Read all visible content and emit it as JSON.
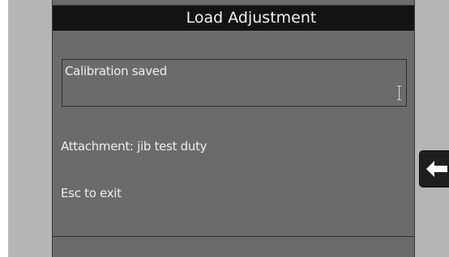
{
  "header": {
    "title": "Load Adjustment"
  },
  "message_box": {
    "text": "Calibration saved"
  },
  "info": {
    "attachment": "Attachment: jib test duty",
    "exit_hint": "Esc to exit"
  },
  "controls": {
    "back_icon": "arrow-left-icon"
  },
  "colors": {
    "screen_background": "#6d6a6b",
    "title_bar": "#141212",
    "bezel": "#b5b5b5",
    "text": "#eeeeee"
  }
}
